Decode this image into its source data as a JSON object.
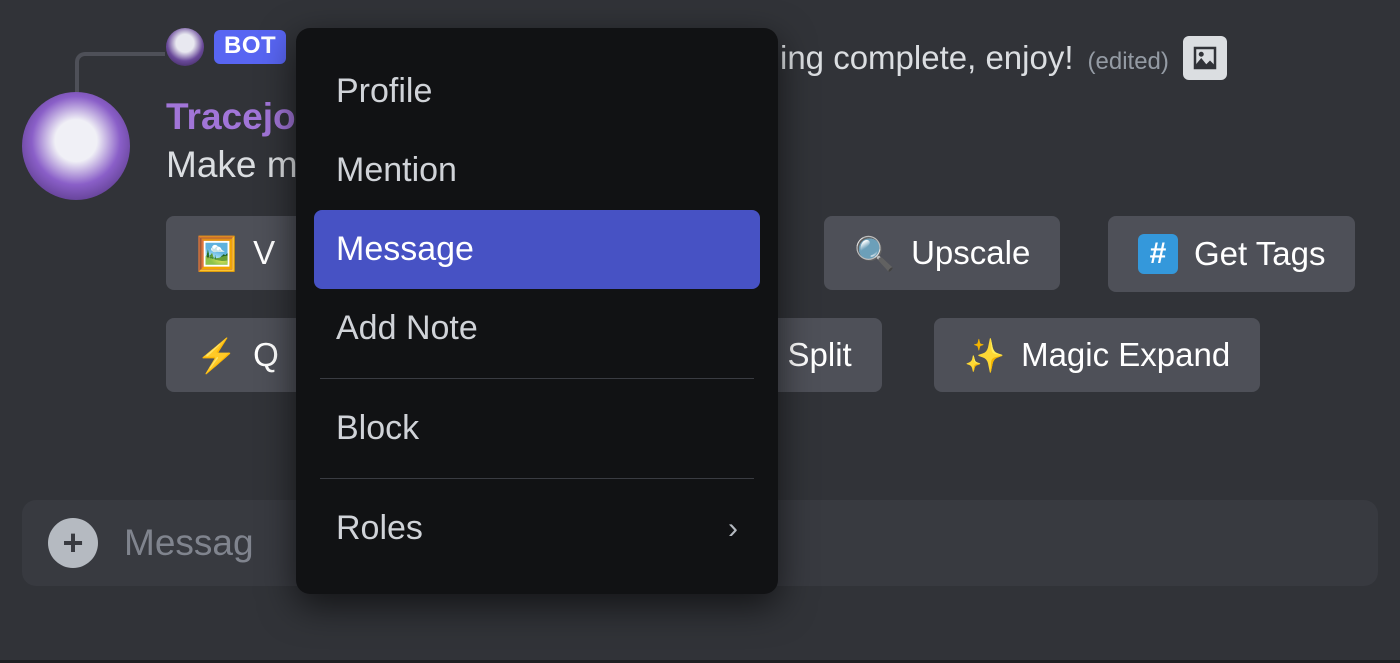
{
  "reply": {
    "bot_tag": "BOT",
    "tail_text": "ing complete, enjoy!",
    "edited_label": "(edited)"
  },
  "message": {
    "username": "Tracejo",
    "text": "Make m",
    "buttons": {
      "overlay_partial": "V",
      "upscale": "Upscale",
      "get_tags": "Get Tags",
      "q_partial": "Q",
      "split_partial": "d Split",
      "magic_expand": "Magic Expand"
    }
  },
  "composer": {
    "placeholder_partial": "Messag"
  },
  "context_menu": {
    "items": [
      {
        "label": "Profile"
      },
      {
        "label": "Mention"
      },
      {
        "label": "Message",
        "hover": true
      },
      {
        "label": "Add Note"
      },
      {
        "sep": true
      },
      {
        "label": "Block"
      },
      {
        "sep": true
      },
      {
        "label": "Roles",
        "submenu": true
      }
    ]
  },
  "icons": {
    "picture": "picture-icon",
    "magnifier": "🔍",
    "lightning": "⚡",
    "sparkle_wand": "✨",
    "frame": "🖼️",
    "plus": "+"
  }
}
